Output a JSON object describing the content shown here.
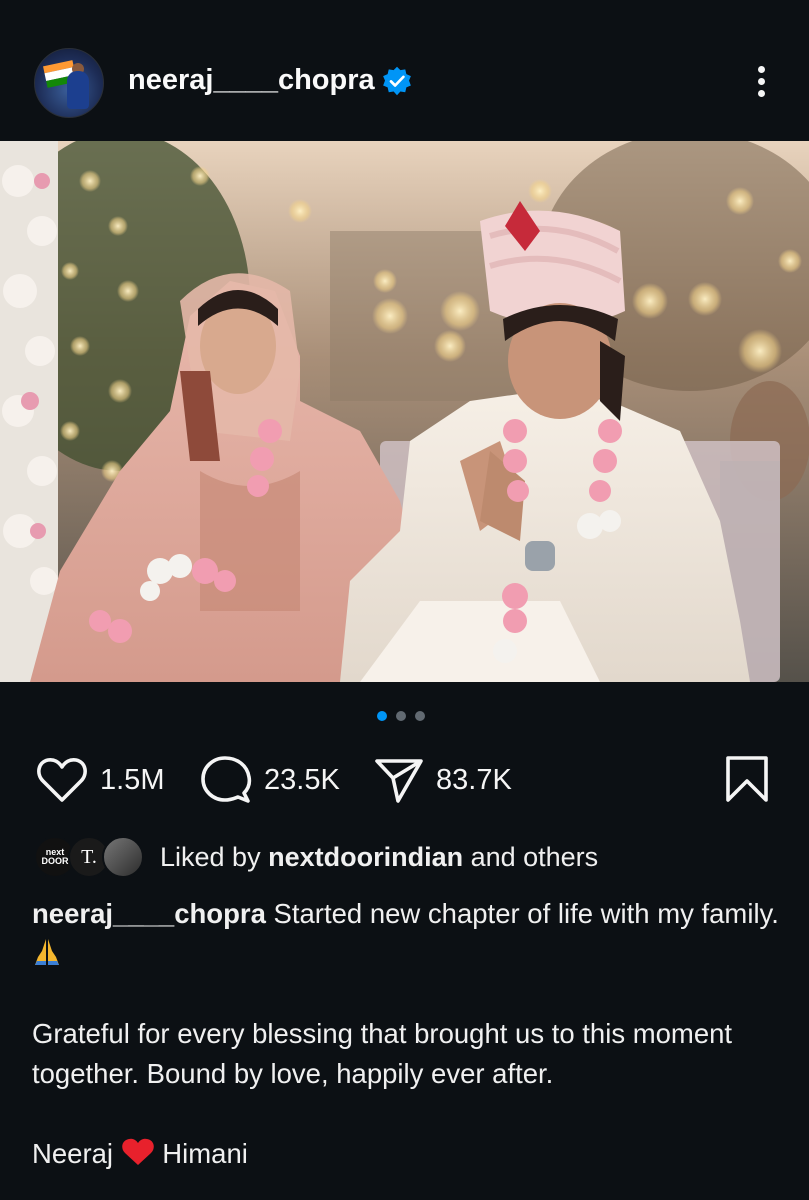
{
  "header": {
    "username": "neeraj____chopra"
  },
  "carousel": {
    "count": 3,
    "active_index": 0
  },
  "actions": {
    "likes": "1.5M",
    "comments": "23.5K",
    "shares": "83.7K"
  },
  "liked_by": {
    "prefix": "Liked by ",
    "user": "nextdoorindian",
    "suffix": " and others",
    "avatars": [
      {
        "name": "nextdoorindian",
        "text": "next DOOR"
      },
      {
        "name": "t-account",
        "text": "T."
      },
      {
        "name": "person-avatar",
        "text": ""
      }
    ]
  },
  "caption": {
    "username": "neeraj____chopra",
    "line1": " Started new chapter of life with my family. ",
    "line2": " Grateful for every blessing that brought us to this moment together. Bound by love, happily ever after.",
    "line3_a": "Neeraj ",
    "line3_b": " Himani"
  },
  "colors": {
    "background": "#0c1014",
    "verified": "#0095f6",
    "active_dot": "#0095f6",
    "heart_emoji": "#e8212c"
  },
  "icons": [
    "verified-badge-icon",
    "more-options-icon",
    "heart-icon",
    "comment-icon",
    "share-icon",
    "bookmark-icon",
    "praying-hands-icon",
    "red-heart-icon"
  ]
}
